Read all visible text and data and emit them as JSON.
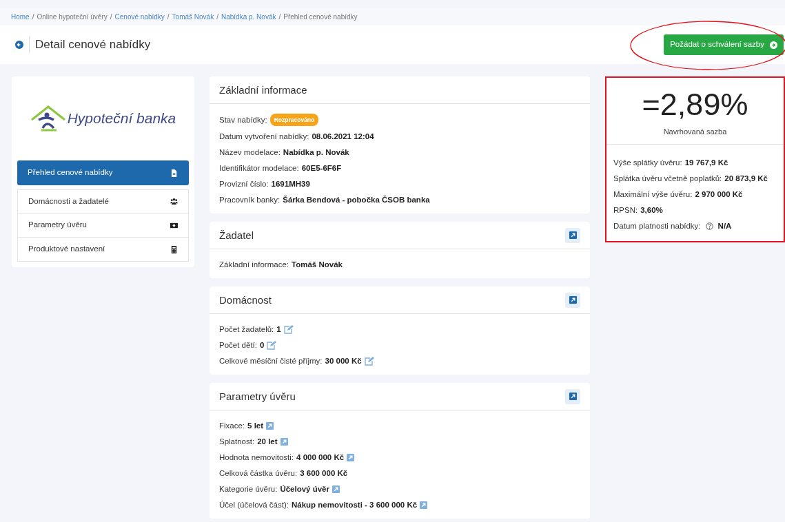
{
  "breadcrumb": [
    {
      "label": "Home",
      "link": true
    },
    {
      "separator": "/",
      "label": "Online hypoteční úvěry",
      "link": false
    },
    {
      "separator": "/",
      "label": "Cenové nabídky",
      "link": true
    },
    {
      "separator": "/",
      "label": "Tomáš Novák",
      "link": true
    },
    {
      "separator": "/",
      "label": "Nabídka p. Novák",
      "link": true
    },
    {
      "separator": "/",
      "label": "Přehled cenové nabídky",
      "link": false
    }
  ],
  "page_title": "Detail cenové nabídky",
  "primary_button": {
    "label": "Požádat o schválení sazby"
  },
  "logo": {
    "text": "Hypoteční banka"
  },
  "sidebar": {
    "items": [
      {
        "label": "Přehled cenové nabídky",
        "selected": true
      },
      {
        "label": "Domácnosti a žadatelé",
        "selected": false
      },
      {
        "label": "Parametry úvěru",
        "selected": false
      },
      {
        "label": "Produktové nastavení",
        "selected": false
      }
    ]
  },
  "sections": [
    {
      "title": "Základní informace",
      "editable": false,
      "fields": [
        {
          "label": "Stav nabídky:",
          "value": "Rozpracováno",
          "kind": "badge"
        },
        {
          "label": "Datum vytvoření nabídky:",
          "value": "08.06.2021 12:04",
          "kind": "text"
        },
        {
          "label": "Název modelace:",
          "value": "Nabídka p. Novák",
          "kind": "text"
        },
        {
          "label": "Identifikátor modelace:",
          "value": "60E5-6F6F",
          "kind": "text"
        },
        {
          "label": "Provizní číslo:",
          "value": "1691MH39",
          "kind": "text"
        },
        {
          "label": "Pracovník banky:",
          "value": "Šárka Bendová - pobočka ČSOB banka",
          "kind": "text"
        }
      ]
    },
    {
      "title": "Žadatel",
      "editable": true,
      "fields": [
        {
          "label": "Základní informace:",
          "value": "Tomáš Novák",
          "kind": "text"
        }
      ]
    },
    {
      "title": "Domácnost",
      "editable": true,
      "fields": [
        {
          "label": "Počet žadatelů:",
          "value": "1",
          "kind": "pencil"
        },
        {
          "label": "Počet dětí:",
          "value": "0",
          "kind": "pencil"
        },
        {
          "label": "Celkové měsíční čisté příjmy:",
          "value": "30 000 Kč",
          "kind": "pencil"
        }
      ]
    },
    {
      "title": "Parametry úvěru",
      "editable": true,
      "fields": [
        {
          "label": "Fixace:",
          "value": "5 let",
          "kind": "link"
        },
        {
          "label": "Splatnost:",
          "value": "20 let",
          "kind": "link"
        },
        {
          "label": "Hodnota nemovitosti:",
          "value": "4 000 000 Kč",
          "kind": "link"
        },
        {
          "label": "Celková částka úvěru:",
          "value": "3 600 000 Kč",
          "kind": "text"
        },
        {
          "label": "Kategorie úvěru:",
          "value": "Účelový úvěr",
          "kind": "link"
        },
        {
          "label": "Účel (účelová část):",
          "value": "Nákup nemovitosti - 3 600 000 Kč",
          "kind": "link"
        }
      ]
    }
  ],
  "rate_card": {
    "rate": "=2,89%",
    "rate_label": "Navrhovaná sazba",
    "fields": [
      {
        "label": "Výše splátky úvěru:",
        "value": "19 767,9 Kč",
        "help": false
      },
      {
        "label": "Splátka úvěru včetně poplatků:",
        "value": "20 873,9 Kč",
        "help": false
      },
      {
        "label": "Maximální výše úvěru:",
        "value": "2 970 000 Kč",
        "help": false
      },
      {
        "label": "RPSN:",
        "value": "3,60%",
        "help": false
      },
      {
        "label": "Datum platnosti nabídky:",
        "value": "N/A",
        "help": true
      }
    ]
  }
}
